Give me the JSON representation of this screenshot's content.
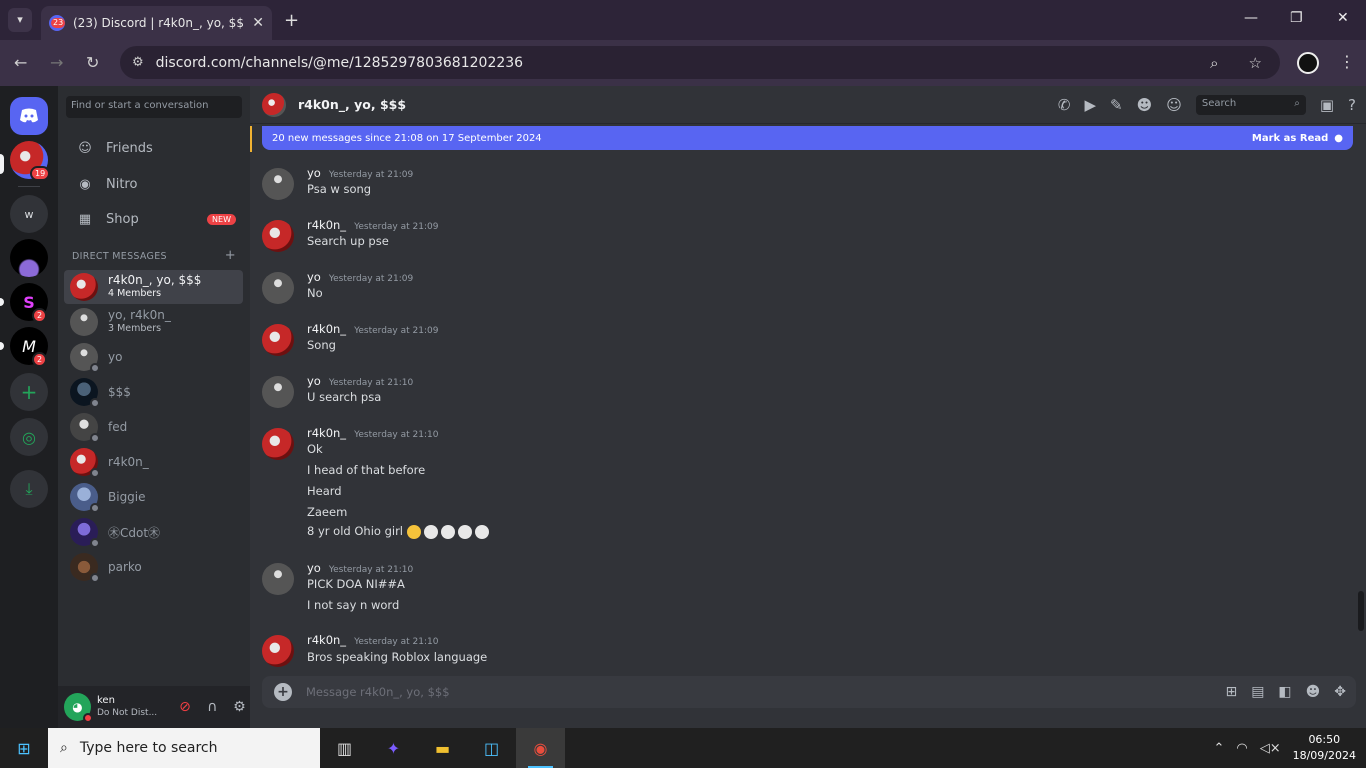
{
  "browser": {
    "tab_title": "(23) Discord | r4k0n_, yo, $$$",
    "tab_badge": "23",
    "url": "discord.com/channels/@me/1285297803681202236"
  },
  "guilds": [
    {
      "name": "Discord home",
      "label": ""
    },
    {
      "name": "group-dm",
      "badge": "19"
    },
    {
      "name": "w",
      "label": "w"
    },
    {
      "name": "server-purple",
      "label": ""
    },
    {
      "name": "server-s",
      "label": "S",
      "badge": "2"
    },
    {
      "name": "server-m",
      "label": "M",
      "badge": "2"
    }
  ],
  "sidebar": {
    "search_placeholder": "Find or start a conversation",
    "friends": "Friends",
    "nitro": "Nitro",
    "shop": "Shop",
    "shop_badge": "NEW",
    "dm_header": "DIRECT MESSAGES",
    "dms": [
      {
        "name": "r4k0n_, yo, $$$",
        "sub": "4 Members"
      },
      {
        "name": "yo, r4k0n_",
        "sub": "3 Members"
      },
      {
        "name": "yo"
      },
      {
        "name": "$$$"
      },
      {
        "name": "fed"
      },
      {
        "name": "r4k0n_"
      },
      {
        "name": "Biggie"
      },
      {
        "name": "㊍Cdot㊍"
      },
      {
        "name": "parko"
      }
    ]
  },
  "user": {
    "name": "ken",
    "status": "Do Not Disturb",
    "status_short": "Do Not Dist..."
  },
  "channel": {
    "title": "r4k0n_, yo, $$$",
    "search_placeholder": "Search",
    "new_messages": "20 new messages since 21:08 on 17 September 2024",
    "mark_read": "Mark as Read",
    "composer_placeholder": "Message r4k0n_, yo, $$$"
  },
  "messages": [
    {
      "author": "yo",
      "time": "Yesterday at 21:09",
      "lines": [
        "Psa w song"
      ]
    },
    {
      "author": "r4k0n_",
      "time": "Yesterday at 21:09",
      "lines": [
        "Search up pse"
      ]
    },
    {
      "author": "yo",
      "time": "Yesterday at 21:09",
      "lines": [
        "No"
      ]
    },
    {
      "author": "r4k0n_",
      "time": "Yesterday at 21:09",
      "lines": [
        "Song"
      ]
    },
    {
      "author": "yo",
      "time": "Yesterday at 21:10",
      "lines": [
        "U search psa"
      ]
    },
    {
      "author": "r4k0n_",
      "time": "Yesterday at 21:10",
      "lines": [
        "Ok",
        "I head of that before",
        "Heard",
        "Zaeem",
        "8 yr old Ohio girl"
      ]
    },
    {
      "author": "yo",
      "time": "Yesterday at 21:10",
      "lines": [
        "PICK DOA NI##A",
        "I not say n word"
      ]
    },
    {
      "author": "r4k0n_",
      "time": "Yesterday at 21:10",
      "lines": [
        "Bros speaking Roblox language"
      ]
    }
  ],
  "taskbar": {
    "search_placeholder": "Type here to search",
    "time": "06:50",
    "date": "18/09/2024"
  }
}
